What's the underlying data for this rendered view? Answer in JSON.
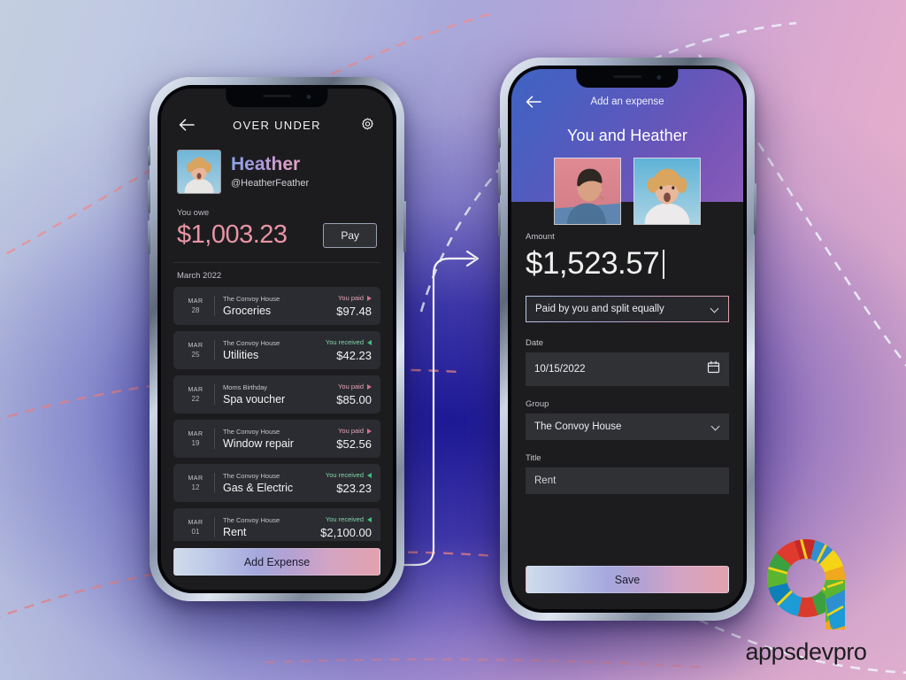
{
  "phone1": {
    "nav": {
      "back_icon": "arrow-left-icon",
      "title": "OVER UNDER",
      "settings_icon": "gear-icon"
    },
    "profile": {
      "avatar": "heather-avatar",
      "name": "Heather",
      "handle": "@HeatherFeather"
    },
    "balance": {
      "label": "You owe",
      "amount": "$1,003.23",
      "pay_label": "Pay"
    },
    "section_month": "March 2022",
    "transactions": [
      {
        "month": "MAR",
        "day": "28",
        "group": "The Convoy House",
        "title": "Groceries",
        "direction": "You paid",
        "dir_type": "paid",
        "amount": "$97.48"
      },
      {
        "month": "MAR",
        "day": "25",
        "group": "The Convoy House",
        "title": "Utilities",
        "direction": "You received",
        "dir_type": "received",
        "amount": "$42.23"
      },
      {
        "month": "MAR",
        "day": "22",
        "group": "Moms Birthday",
        "title": "Spa voucher",
        "direction": "You paid",
        "dir_type": "paid",
        "amount": "$85.00"
      },
      {
        "month": "MAR",
        "day": "19",
        "group": "The Convoy House",
        "title": "Window repair",
        "direction": "You paid",
        "dir_type": "paid",
        "amount": "$52.56"
      },
      {
        "month": "MAR",
        "day": "12",
        "group": "The Convoy House",
        "title": "Gas & Electric",
        "direction": "You received",
        "dir_type": "received",
        "amount": "$23.23"
      },
      {
        "month": "MAR",
        "day": "01",
        "group": "The Convoy House",
        "title": "Rent",
        "direction": "You received",
        "dir_type": "received",
        "amount": "$2,100.00"
      }
    ],
    "primary_button": "Add Expense"
  },
  "phone2": {
    "nav": {
      "back_icon": "arrow-left-icon",
      "title": "Add an expense"
    },
    "heading": "You and Heather",
    "avatars": [
      "you-avatar",
      "heather-avatar"
    ],
    "amount_field": {
      "label": "Amount",
      "value": "$1,523.57"
    },
    "split_select": {
      "value": "Paid by you and split equally",
      "icon": "chevron-down-icon"
    },
    "date_field": {
      "label": "Date",
      "value": "10/15/2022",
      "icon": "calendar-icon"
    },
    "group_field": {
      "label": "Group",
      "value": "The Convoy House",
      "icon": "chevron-down-icon"
    },
    "title_field": {
      "label": "Title",
      "value": "Rent"
    },
    "primary_button": "Save"
  },
  "branding": {
    "logo_mark": "appsdevpro-logo-icon",
    "logo_text": "appsdevpro"
  },
  "colors": {
    "accent_pink": "#e894a4",
    "accent_green": "#3fbf7f",
    "screen_bg": "#1c1c1e",
    "card_bg": "#2b2c31",
    "hero_start": "#3f63c4",
    "hero_end": "#8a5cb8"
  }
}
